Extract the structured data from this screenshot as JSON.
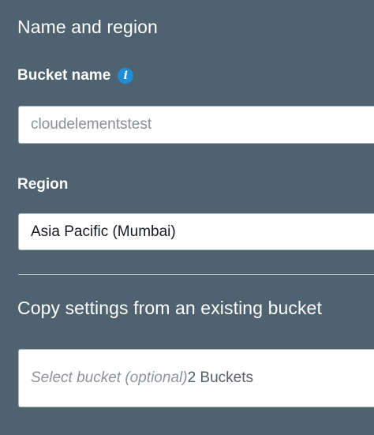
{
  "name_region_section": {
    "title": "Name and region"
  },
  "bucket_name": {
    "label": "Bucket name",
    "info_icon": "info-icon",
    "value": "cloudelementstest"
  },
  "region": {
    "label": "Region",
    "selected": "Asia Pacific (Mumbai)"
  },
  "copy_settings": {
    "title": "Copy settings from an existing bucket",
    "placeholder": "Select bucket (optional)",
    "count": "2 Buckets"
  },
  "colors": {
    "background": "#4f6270",
    "info_icon": "#1f8dd6",
    "input_background": "#ffffff"
  }
}
